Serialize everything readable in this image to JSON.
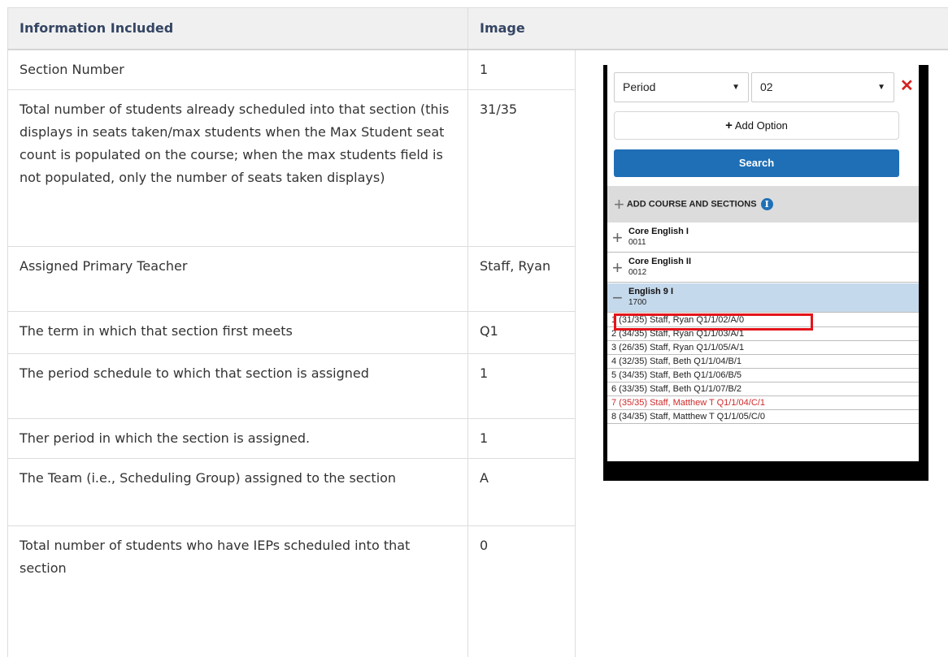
{
  "table": {
    "headers": [
      "Information Included",
      "Image"
    ],
    "rows": [
      {
        "info": "Section Number",
        "value": "1"
      },
      {
        "info": "Total number of students already scheduled into that section (this displays in seats taken/max students when the Max Student seat count is populated on the course; when the max students field is not populated, only the number of seats taken displays)",
        "value": "31/35"
      },
      {
        "info": "Assigned Primary Teacher",
        "value": "Staff, Ryan"
      },
      {
        "info": "The term in which that section first meets",
        "value": "Q1"
      },
      {
        "info": "The period schedule to which that section is assigned",
        "value": "1"
      },
      {
        "info": "Ther period in which the section is assigned.",
        "value": "1"
      },
      {
        "info": "The Team (i.e., Scheduling Group) assigned to the section",
        "value": "A"
      },
      {
        "info": "Total number of students who have IEPs scheduled into that section",
        "value": "0"
      }
    ]
  },
  "panel": {
    "filter_field": "Period",
    "filter_value": "02",
    "add_option_label": "Add Option",
    "search_label": "Search",
    "add_course_label": "ADD COURSE AND SECTIONS",
    "courses": [
      {
        "name": "Core English I",
        "code": "0011",
        "expanded": false
      },
      {
        "name": "Core English II",
        "code": "0012",
        "expanded": false
      },
      {
        "name": "English 9 I",
        "code": "1700",
        "expanded": true
      }
    ],
    "sections": [
      {
        "text": "1 (31/35) Staff, Ryan  Q1/1/02/A/0",
        "full": false,
        "highlighted": true
      },
      {
        "text": "2 (34/35) Staff, Ryan  Q1/1/03/A/1",
        "full": false
      },
      {
        "text": "3 (26/35) Staff, Ryan  Q1/1/05/A/1",
        "full": false
      },
      {
        "text": "4 (32/35) Staff, Beth  Q1/1/04/B/1",
        "full": false
      },
      {
        "text": "5 (34/35) Staff, Beth  Q1/1/06/B/5",
        "full": false
      },
      {
        "text": "6 (33/35) Staff, Beth  Q1/1/07/B/2",
        "full": false
      },
      {
        "text": "7 (35/35) Staff, Matthew T  Q1/1/04/C/1",
        "full": true
      },
      {
        "text": "8 (34/35) Staff, Matthew T  Q1/1/05/C/0",
        "full": false
      }
    ],
    "colors": {
      "accent": "#1f6fb6",
      "full_section": "#cf2a2a",
      "highlight": "#e4141b",
      "active_course": "#c5d9ec"
    }
  }
}
